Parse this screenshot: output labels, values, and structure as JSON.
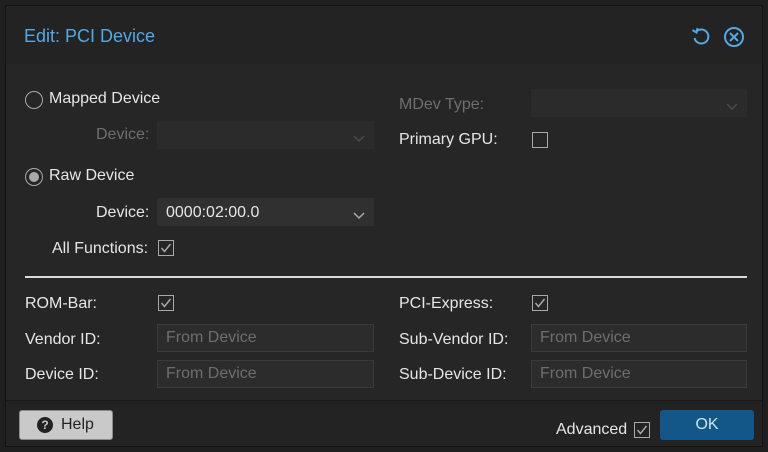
{
  "dialog": {
    "title": "Edit: PCI Device",
    "reset_icon": "reset-icon",
    "close_icon": "close-icon"
  },
  "mapped_device": {
    "label": "Mapped Device",
    "checked": false,
    "device_label": "Device:",
    "device_value": ""
  },
  "raw_device": {
    "label": "Raw Device",
    "checked": true,
    "device_label": "Device:",
    "device_value": "0000:02:00.0",
    "all_functions_label": "All Functions:",
    "all_functions_checked": true
  },
  "mdev": {
    "label": "MDev Type:",
    "value": ""
  },
  "primary_gpu": {
    "label": "Primary GPU:",
    "checked": false
  },
  "advanced": {
    "rom_bar_label": "ROM-Bar:",
    "rom_bar_checked": true,
    "pci_express_label": "PCI-Express:",
    "pci_express_checked": true,
    "vendor_id_label": "Vendor ID:",
    "vendor_id_placeholder": "From Device",
    "sub_vendor_id_label": "Sub-Vendor ID:",
    "sub_vendor_id_placeholder": "From Device",
    "device_id_label": "Device ID:",
    "device_id_placeholder": "From Device",
    "sub_device_id_label": "Sub-Device ID:",
    "sub_device_id_placeholder": "From Device"
  },
  "footer": {
    "help_label": "Help",
    "help_icon": "question-circle-icon",
    "advanced_label": "Advanced",
    "advanced_checked": true,
    "ok_label": "OK"
  },
  "colors": {
    "accent": "#53a8e6",
    "ok_button": "#135788",
    "background": "#262626"
  }
}
